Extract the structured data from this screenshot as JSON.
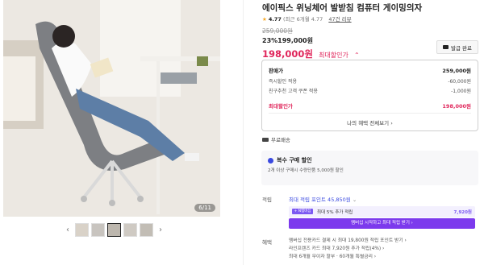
{
  "gallery": {
    "counter": "6/11",
    "prev_arrow": "‹",
    "next_arrow": "›",
    "thumbnail_count": 5,
    "active_index": 2
  },
  "product": {
    "title": "에이픽스 위닝체어 발받침 컴퓨터 게이밍의자",
    "rating": "4.77",
    "rating_detail": "(최근 6개월 4.77",
    "reviews": "47건 리뷰"
  },
  "price": {
    "original": "259,000원",
    "discount_pct": "23%",
    "discounted": "199,000원",
    "final": "198,000원",
    "final_label": "최대할인가",
    "final_chevron": "⌃",
    "coupon_button": "발급 완료"
  },
  "breakdown": {
    "rows": [
      {
        "label": "판매가",
        "value": "259,000원"
      },
      {
        "label": "즉시할인 적용",
        "value": "-60,000원"
      },
      {
        "label": "친구추천 고객 쿠폰 적용",
        "value": "-1,000원"
      },
      {
        "label": "최대할인가",
        "value": "198,000원"
      }
    ],
    "view_all": "나의 혜택 전체보기 ›"
  },
  "shipping": {
    "label": "무료배송"
  },
  "multi_purchase": {
    "title": "복수 구매 할인",
    "subtitle": "2개 이상 구매시 수량단품 5,000원 할인"
  },
  "points": {
    "label": "적립",
    "value": "최대 적립 포인트 45,850원",
    "chevron": "⌄",
    "membership_badge": "+ N멤버십",
    "membership_text": "최대 5% 추가 적립",
    "membership_amount": "7,920원",
    "membership_button": "멤버십 시작하고 최대 적립 받기 ›"
  },
  "benefits": {
    "label": "혜택",
    "lines": [
      "멤버십 전용카드 결제 시 최대 19,800원 적립 포인트 받기 ›",
      "라인프렌즈 카드 최대 7,920원 추가 적립(4%) ›",
      "최대 6개월 무이자 할부 · 60개월 특별금리 ›"
    ]
  },
  "colors": {
    "accent_red": "#e0265b",
    "accent_purple": "#7c3aed",
    "accent_blue": "#3a49e0"
  }
}
